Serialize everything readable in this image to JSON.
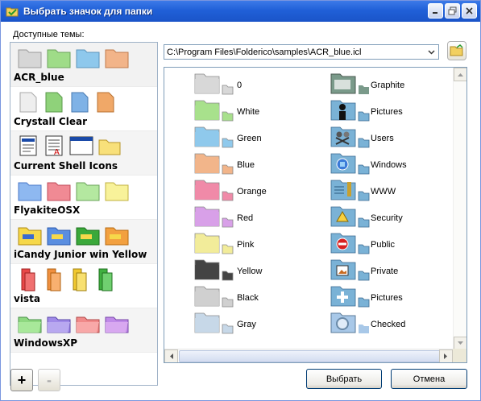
{
  "window": {
    "title": "Выбрать значок для папки"
  },
  "themes": {
    "label": "Доступные темы:",
    "items": [
      {
        "name": "ACR_blue",
        "selected": true
      },
      {
        "name": "Crystall Clear"
      },
      {
        "name": "Current Shell Icons"
      },
      {
        "name": "FlyakiteOSX"
      },
      {
        "name": "iCandy Junior win Yellow"
      },
      {
        "name": "vista"
      },
      {
        "name": "WindowsXP"
      }
    ]
  },
  "path": {
    "value": "C:\\Program Files\\Folderico\\samples\\ACR_blue.icl"
  },
  "icons": {
    "left": [
      {
        "label": "0",
        "color": "#d8d8d8"
      },
      {
        "label": "White",
        "color": "#a8e08c"
      },
      {
        "label": "Green",
        "color": "#8fc9ec"
      },
      {
        "label": "Blue",
        "color": "#f2b58a"
      },
      {
        "label": "Orange",
        "color": "#f08aa8"
      },
      {
        "label": "Red",
        "color": "#d8a0e8"
      },
      {
        "label": "Pink",
        "color": "#f2ec9a"
      },
      {
        "label": "Yellow",
        "color": "#444444"
      },
      {
        "label": "Black",
        "color": "#d0d0d0"
      },
      {
        "label": "Gray",
        "color": "#c7d8e8"
      }
    ],
    "right": [
      {
        "label": "Graphite",
        "icon": "graphite-folder-icon"
      },
      {
        "label": "Pictures",
        "icon": "user-folder-icon"
      },
      {
        "label": "Users",
        "icon": "users-folder-icon"
      },
      {
        "label": "Windows",
        "icon": "windows-folder-icon"
      },
      {
        "label": "WWW",
        "icon": "www-folder-icon"
      },
      {
        "label": "Security",
        "icon": "security-folder-icon"
      },
      {
        "label": "Public",
        "icon": "public-folder-icon"
      },
      {
        "label": "Private",
        "icon": "private-folder-icon"
      },
      {
        "label": "Pictures",
        "icon": "add-folder-icon"
      },
      {
        "label": "Checked",
        "icon": "checked-folder-icon"
      }
    ]
  },
  "buttons": {
    "add": "+",
    "remove": "-",
    "select": "Выбрать",
    "cancel": "Отмена"
  }
}
